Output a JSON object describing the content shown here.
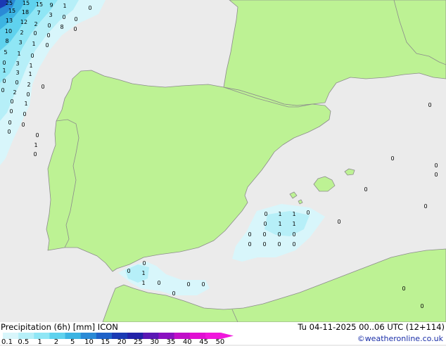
{
  "title": {
    "left": "Precipitation (6h) [mm] ICON",
    "right": "Tu 04-11-2025 00..06 UTC (12+114)",
    "credit": "©weatheronline.co.uk"
  },
  "colors": {
    "land": "#bdf294",
    "sea": "#ebebeb",
    "border": "#8c8c8c"
  },
  "legend": {
    "ticks": [
      "0.1",
      "0.5",
      "1",
      "2",
      "5",
      "10",
      "15",
      "20",
      "25",
      "30",
      "35",
      "40",
      "45",
      "50"
    ],
    "colors": [
      "#d8f6fb",
      "#b6eff8",
      "#8fe6f5",
      "#5fd2ee",
      "#3cb4e2",
      "#2a8ad6",
      "#1f62c8",
      "#1a3ab4",
      "#2222a8",
      "#5a18b4",
      "#8a10c0",
      "#c00ec8",
      "#e010d2",
      "#f018dc"
    ]
  },
  "values": {
    "atlantic": [
      "25",
      "15",
      "15",
      "9",
      "1",
      "0",
      "15",
      "18",
      "7",
      "3",
      "0",
      "0",
      "13",
      "12",
      "2",
      "0",
      "8",
      "0",
      "10",
      "2",
      "0",
      "0",
      "8",
      "3",
      "1",
      "0",
      "5",
      "1",
      "0",
      "0",
      "3",
      "1",
      "1",
      "3",
      "1",
      "0",
      "0",
      "2",
      "0",
      "0",
      "2",
      "0",
      "0",
      "1",
      "0",
      "0",
      "0",
      "0",
      "0",
      "0",
      "1",
      "0"
    ],
    "alboran": [
      "0",
      "1",
      "1",
      "0",
      "0",
      "0",
      "0",
      "0"
    ],
    "algeria": [
      "0",
      "1",
      "1",
      "0",
      "0",
      "1",
      "1",
      "0",
      "0",
      "0",
      "0",
      "0",
      "0",
      "0",
      "0"
    ],
    "east": [
      "0",
      "0",
      "0",
      "0",
      "0",
      "0",
      "0",
      "0",
      "0"
    ]
  }
}
